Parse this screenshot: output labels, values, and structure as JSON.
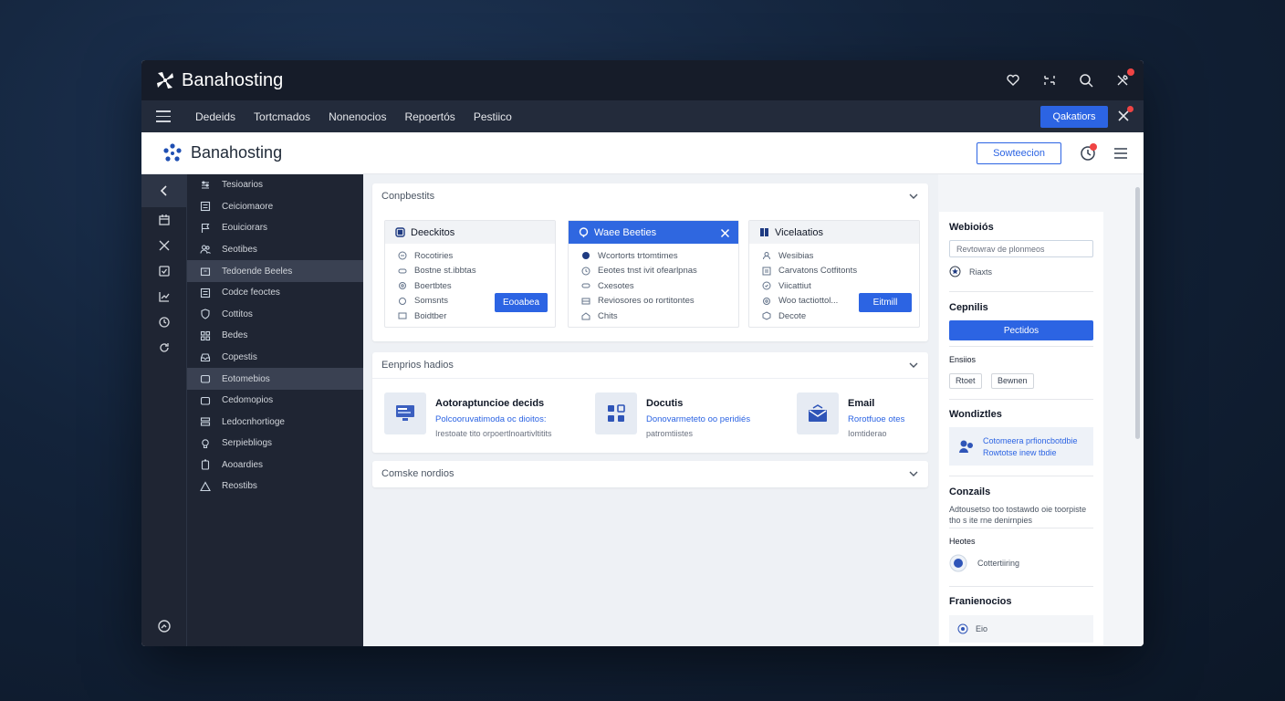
{
  "app": {
    "name": "Banahosting"
  },
  "topbar": {
    "icons": [
      "heart-icon",
      "share-icon",
      "search-icon",
      "tools-icon"
    ]
  },
  "navbar": {
    "items": [
      "Dedeids",
      "Tortcmados",
      "Nonenocios",
      "Repoertós",
      "Pestiico"
    ],
    "button": "Qakatiors"
  },
  "header": {
    "brand": "Banahosting",
    "outline_button": "Sowteecion"
  },
  "sidebar": {
    "items": [
      {
        "label": "Tesioarios",
        "icon": "sliders-icon"
      },
      {
        "label": "Ceiciomaore",
        "icon": "list-icon"
      },
      {
        "label": "Eouiciorars",
        "icon": "flag-icon"
      },
      {
        "label": "Seotibes",
        "icon": "users-icon"
      },
      {
        "label": "Tedoende Beeles",
        "icon": "archive-icon",
        "selected": true
      },
      {
        "label": "Codce feoctes",
        "icon": "list-icon"
      },
      {
        "label": "Cottitos",
        "icon": "shield-icon"
      },
      {
        "label": "Bedes",
        "icon": "grid-icon"
      },
      {
        "label": "Copestis",
        "icon": "inbox-icon"
      },
      {
        "label": "Eotomebios",
        "icon": "box-icon",
        "selected": true
      },
      {
        "label": "Cedomopios",
        "icon": "box-icon"
      },
      {
        "label": "Ledocnhortioge",
        "icon": "database-icon"
      },
      {
        "label": "Serpiebliogs",
        "icon": "bulb-icon"
      },
      {
        "label": "Aooardies",
        "icon": "battery-icon"
      },
      {
        "label": "Reostibs",
        "icon": "warning-icon"
      }
    ]
  },
  "main": {
    "panel1": {
      "title": "Conpbestits",
      "cards": [
        {
          "title": "Deeckitos",
          "rows": [
            "Rocotiries",
            "Bostne st.ibbtas",
            "Boertbtes",
            "Somsnts",
            "Boidtber"
          ],
          "button": "Eooabea"
        },
        {
          "title": "Waee Beeties",
          "rows": [
            "Wcortorts trtomtimes",
            "Eeotes tnst ivit ofearlpnas",
            "Cxesotes",
            "Reviosores oo rortitontes",
            "Chits"
          ]
        },
        {
          "title": "Vicelaatios",
          "rows": [
            "Wesibias",
            "Carvatons Cotfitonts",
            "Viicattiut",
            "Woo tactiottol...",
            "Decote"
          ],
          "button": "Eitmill"
        }
      ]
    },
    "panel2": {
      "title": "Eenprios hadios",
      "features": [
        {
          "title": "Aotoraptuncioe decids",
          "link": "Polcooruvatimoda oc dioitos:",
          "sub": "Irestoate tito orpoertlnoartivltitits"
        },
        {
          "title": "Docutis",
          "link": "Donovarmeteto oo peridiés",
          "sub": "patromtiistes"
        },
        {
          "title": "Email",
          "link": "Rorotfuoe otes",
          "sub": "Iomtiderao"
        }
      ]
    },
    "panel3": {
      "title": "Comske nordios"
    }
  },
  "rightpanel": {
    "websites": {
      "title": "Webioiós",
      "input_value": "Revtowrav de plonmeos",
      "radio_label": "Riaxts"
    },
    "cepnilis": {
      "title": "Cepnilis",
      "button": "Pectidos"
    },
    "ensiios": {
      "title": "Ensiios",
      "tags": [
        "Rtoet",
        "Bewnen"
      ]
    },
    "wondiztles": {
      "title": "Wondiztles",
      "line1": "Cotomeera prfioncbotdbie",
      "line2": "Rowtotse inew tbdie"
    },
    "contails": {
      "title": "Conzails",
      "text": "Adtousetso too tostawdo oie toorpiste tho s ite rne denirnpies"
    },
    "heotes": {
      "title": "Heotes",
      "item": "Cottertiiring"
    },
    "franienocios": {
      "title": "Franienocios",
      "item": "Eio"
    }
  },
  "colors": {
    "accent": "#2c64e3",
    "dark": "#161c29",
    "sidebar": "#1f2533"
  }
}
